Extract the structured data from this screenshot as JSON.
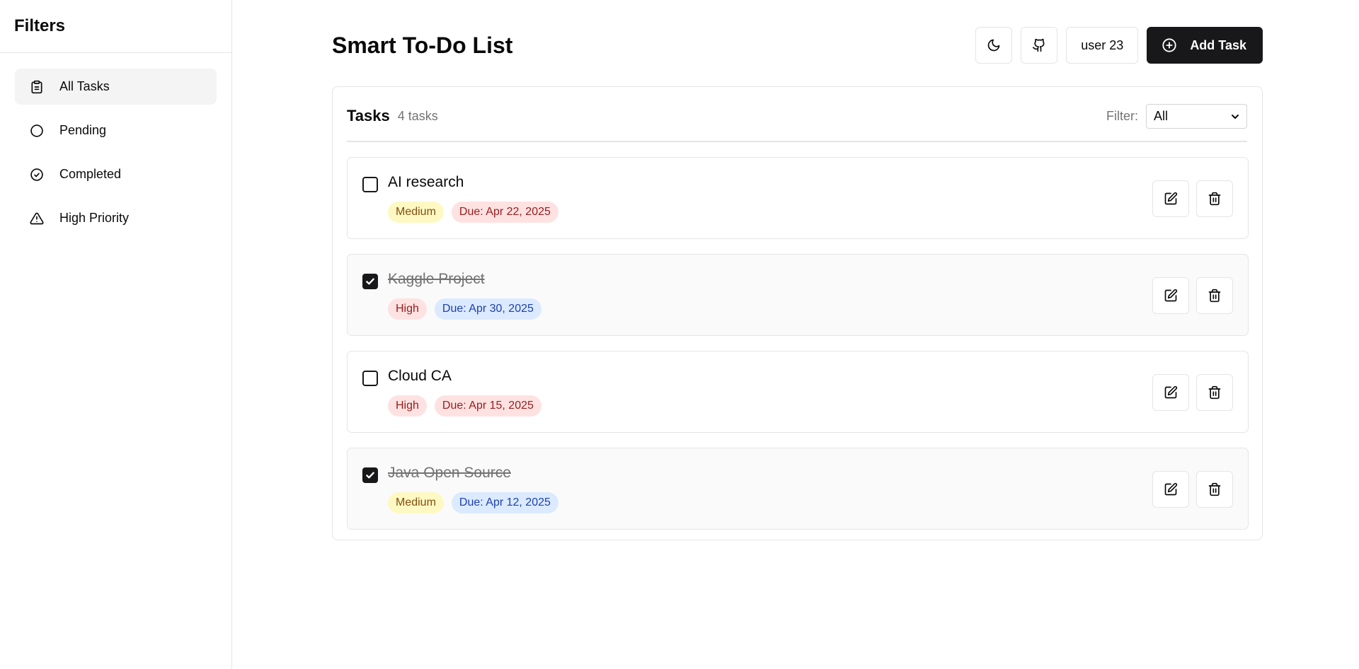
{
  "sidebar": {
    "title": "Filters",
    "items": [
      {
        "label": "All Tasks",
        "icon": "clipboard-icon",
        "active": true
      },
      {
        "label": "Pending",
        "icon": "circle-icon",
        "active": false
      },
      {
        "label": "Completed",
        "icon": "check-circle-icon",
        "active": false
      },
      {
        "label": "High Priority",
        "icon": "alert-triangle-icon",
        "active": false
      }
    ]
  },
  "header": {
    "title": "Smart To-Do List",
    "theme_icon": "moon-icon",
    "github_icon": "github-icon",
    "user_label": "user 23",
    "add_label": "Add Task",
    "add_icon": "plus-circle-icon"
  },
  "tasks_panel": {
    "title": "Tasks",
    "count": "4 tasks",
    "filter_label": "Filter:",
    "filter_value": "All"
  },
  "tasks": [
    {
      "title": "AI research",
      "completed": false,
      "priority": "Medium",
      "due": "Due: Apr 22, 2025",
      "due_color": "#fee2e2"
    },
    {
      "title": "Kaggle Project",
      "completed": true,
      "priority": "High",
      "due": "Due: Apr 30, 2025",
      "due_color": "#dbeafe"
    },
    {
      "title": "Cloud CA",
      "completed": false,
      "priority": "High",
      "due": "Due: Apr 15, 2025",
      "due_color": "#fee2e2"
    },
    {
      "title": "Java Open Source",
      "completed": true,
      "priority": "Medium",
      "due": "Due: Apr 12, 2025",
      "due_color": "#dbeafe"
    }
  ],
  "colors": {
    "primary": "#18181b",
    "border": "#e5e5e5",
    "muted": "#737373",
    "medium_badge": "#fef9c3",
    "high_badge": "#fee2e2"
  }
}
